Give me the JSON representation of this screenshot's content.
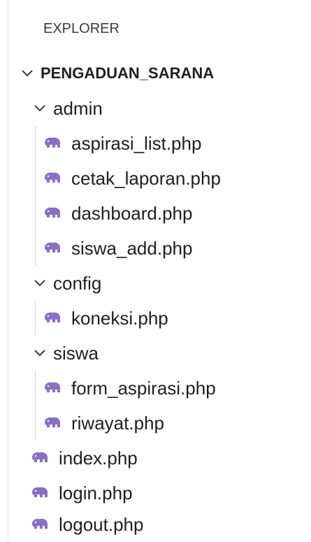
{
  "explorer": {
    "header": "EXPLORER",
    "root": {
      "label": "PENGADUAN_SARANA",
      "expanded": true,
      "children": [
        {
          "type": "folder",
          "label": "admin",
          "expanded": true,
          "children": [
            {
              "type": "file",
              "label": "aspirasi_list.php",
              "icon": "php-elephant-icon"
            },
            {
              "type": "file",
              "label": "cetak_laporan.php",
              "icon": "php-elephant-icon"
            },
            {
              "type": "file",
              "label": "dashboard.php",
              "icon": "php-elephant-icon"
            },
            {
              "type": "file",
              "label": "siswa_add.php",
              "icon": "php-elephant-icon"
            }
          ]
        },
        {
          "type": "folder",
          "label": "config",
          "expanded": true,
          "children": [
            {
              "type": "file",
              "label": "koneksi.php",
              "icon": "php-elephant-icon"
            }
          ]
        },
        {
          "type": "folder",
          "label": "siswa",
          "expanded": true,
          "children": [
            {
              "type": "file",
              "label": "form_aspirasi.php",
              "icon": "php-elephant-icon"
            },
            {
              "type": "file",
              "label": "riwayat.php",
              "icon": "php-elephant-icon"
            }
          ]
        },
        {
          "type": "file",
          "label": "index.php",
          "icon": "php-elephant-icon"
        },
        {
          "type": "file",
          "label": "login.php",
          "icon": "php-elephant-icon"
        },
        {
          "type": "file",
          "label": "logout.php",
          "icon": "php-elephant-icon"
        }
      ]
    }
  },
  "colors": {
    "php_icon": "#8b6fc7",
    "chevron": "#3b3b3b",
    "text": "#1f1f1f",
    "guide": "#d4d4d4"
  }
}
